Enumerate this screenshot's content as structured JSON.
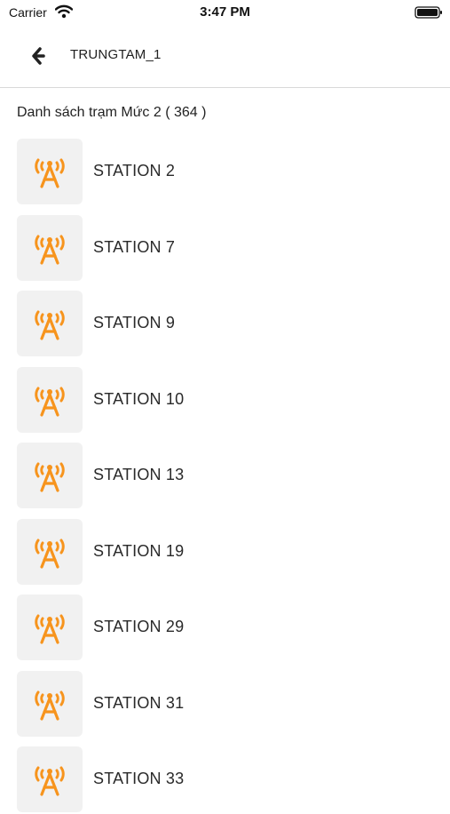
{
  "status_bar": {
    "carrier": "Carrier",
    "time": "3:47 PM"
  },
  "header": {
    "title": "TRUNGTAM_1"
  },
  "list": {
    "heading": "Danh sách trạm Mức 2 ( 364 )",
    "icon": "antenna-tower-icon",
    "icon_color": "#f7941d",
    "stations": [
      {
        "name": "STATION 2"
      },
      {
        "name": "STATION 7"
      },
      {
        "name": "STATION 9"
      },
      {
        "name": "STATION 10"
      },
      {
        "name": "STATION 13"
      },
      {
        "name": "STATION 19"
      },
      {
        "name": "STATION 29"
      },
      {
        "name": "STATION 31"
      },
      {
        "name": "STATION 33"
      }
    ]
  }
}
